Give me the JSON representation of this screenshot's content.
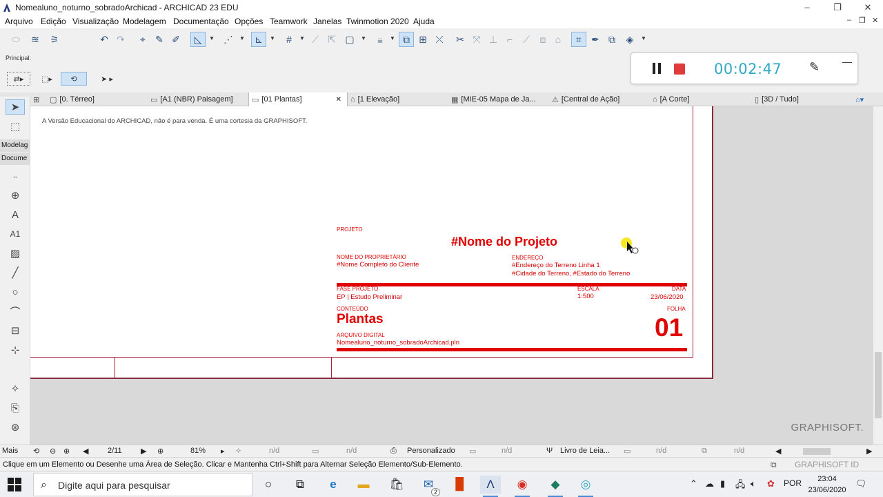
{
  "window": {
    "title": "Nomealuno_noturno_sobradoArchicad - ARCHICAD 23 EDU",
    "minimize": "–",
    "maximize": "❐",
    "close": "✕"
  },
  "menu": [
    "Arquivo",
    "Edição",
    "Visualização",
    "Modelagem",
    "Documentação",
    "Opções",
    "Teamwork",
    "Janelas",
    "Twinmotion 2020",
    "Ajuda"
  ],
  "principal_label": "Principal:",
  "recorder": {
    "time": "00:02:47"
  },
  "tabs": [
    {
      "label": "[0. Térreo]",
      "icon": "floorplan-icon"
    },
    {
      "label": "[A1 (NBR) Paisagem]",
      "icon": "layout-icon"
    },
    {
      "label": "[01 Plantas]",
      "icon": "layout-icon",
      "active": true,
      "close": "✕"
    },
    {
      "label": "[1 Elevação]",
      "icon": "elevation-icon"
    },
    {
      "label": "[MIE-05 Mapa de Ja...",
      "icon": "schedule-icon"
    },
    {
      "label": "[Central de Ação]",
      "icon": "action-center-icon"
    },
    {
      "label": "[A Corte]",
      "icon": "section-icon"
    },
    {
      "label": "[3D / Tudo]",
      "icon": "3d-icon"
    }
  ],
  "toolbox": {
    "modeling_header": "Modelag",
    "document_header": "Docume",
    "label_tool": "A1"
  },
  "sheet": {
    "edu_notice": "A Versão Educacional do ARCHICAD, não é para venda. É uma cortesia da GRAPHISOFT.",
    "projeto_label": "PROJETO",
    "projeto_value": "#Nome do Projeto",
    "proprietario_label": "NOME DO PROPRIETÁRIO",
    "proprietario_value": "#Nome Completo do Cliente",
    "endereco_label": "ENDEREÇO",
    "endereco_line1": "#Endereço do Terreno Linha 1",
    "endereco_line2": "#Cidade do Terreno, #Estado do Terreno",
    "fase_label": "FASE PROJETO",
    "fase_value": "EP | Estudo Preliminar",
    "escala_label": "ESCALA",
    "escala_value": "1:500",
    "data_label": "DATA",
    "data_value": "23/06/2020",
    "conteudo_label": "CONTEÚDO",
    "conteudo_value": "Plantas",
    "folha_label": "FOLHA",
    "folha_value": "01",
    "arquivo_label": "ARQUIVO DIGITAL",
    "arquivo_value": "Nomealuno_noturno_sobradoArchicad.pln"
  },
  "watermark": "GRAPHISOFT.",
  "navbar": {
    "mais": "Mais",
    "page": "2/11",
    "zoom": "81%",
    "nd1": "n/d",
    "nd2": "n/d",
    "custom": "Personalizado",
    "nd3": "n/d",
    "pen_set": "Livro de Leia...",
    "nd4": "n/d",
    "nd5": "n/d"
  },
  "status": {
    "message": "Clique em um Elemento ou Desenhe uma Área de Seleção. Clicar e Mantenha Ctrl+Shift para Alternar Seleção Elemento/Sub-Elemento.",
    "graphisoft_id": "GRAPHISOFT ID"
  },
  "taskbar": {
    "search_placeholder": "Digite aqui para pesquisar",
    "language": "POR",
    "time": "23:04",
    "date": "23/06/2020",
    "mail_badge": "2"
  }
}
